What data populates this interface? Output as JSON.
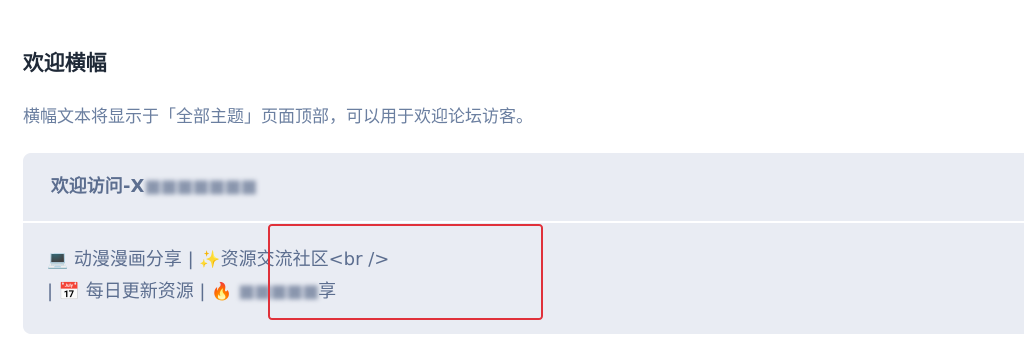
{
  "section": {
    "title": "欢迎横幅",
    "description": "横幅文本将显示于「全部主题」页面顶部，可以用于欢迎论坛访客。"
  },
  "banner": {
    "title_prefix": "欢迎访问-X",
    "title_redacted": "■■■■■■■",
    "body_line1_emoji1": "💻",
    "body_line1_text1": " 动漫漫画分享 | ",
    "body_line1_emoji2": "✨",
    "body_line1_text2": "资源交流社区<br />",
    "body_line2_text1": "| ",
    "body_line2_emoji1": "📅",
    "body_line2_text2": " 每日更新资源 | ",
    "body_line2_emoji2": "🔥",
    "body_line2_redacted": "■■■■■",
    "body_line2_text3": "享"
  },
  "icons": {
    "resize": "resize-handle-icon"
  },
  "colors": {
    "highlight": "#e0313a",
    "field_bg": "#e9ecf3",
    "text": "#5c6e8f"
  }
}
